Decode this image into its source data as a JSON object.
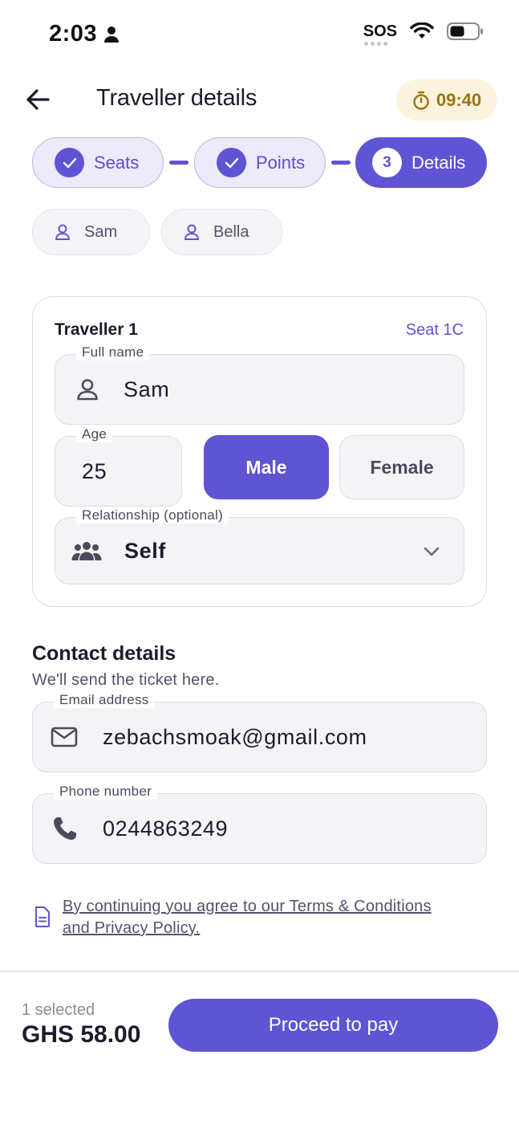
{
  "status_bar": {
    "time": "2:03",
    "sos": "SOS"
  },
  "header": {
    "title": "Traveller details",
    "timer": "09:40"
  },
  "stepper": {
    "steps": [
      {
        "label": "Seats",
        "state": "done"
      },
      {
        "label": "Points",
        "state": "done"
      },
      {
        "label": "Details",
        "number": "3",
        "state": "active"
      }
    ]
  },
  "travellers": [
    {
      "name": "Sam"
    },
    {
      "name": "Bella"
    }
  ],
  "traveller_card": {
    "title": "Traveller 1",
    "seat": "Seat 1C",
    "full_name": {
      "label": "Full name",
      "value": "Sam"
    },
    "age": {
      "label": "Age",
      "value": "25"
    },
    "gender": {
      "male": "Male",
      "female": "Female",
      "selected": "Male"
    },
    "relationship": {
      "label": "Relationship (optional)",
      "value": "Self"
    }
  },
  "contact": {
    "title": "Contact details",
    "subtitle": "We'll send the ticket here.",
    "email": {
      "label": "Email address",
      "value": "zebachsmoak@gmail.com"
    },
    "phone": {
      "label": "Phone number",
      "value": "0244863249"
    }
  },
  "terms": {
    "line1": "By continuing you agree to our Terms & Conditions",
    "line2": "and Privacy Policy."
  },
  "footer": {
    "selected": "1 selected",
    "price": "GHS 58.00",
    "cta": "Proceed to pay"
  },
  "colors": {
    "accent": "#5f54d3",
    "accent_light": "#eceafb",
    "timer_bg": "#fbf3dd",
    "timer_text": "#9a7414",
    "field_bg": "#f4f4f7"
  }
}
